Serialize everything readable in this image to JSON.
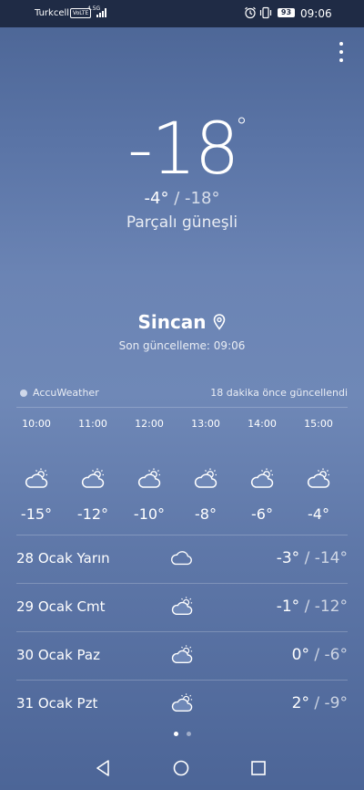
{
  "status_bar": {
    "carrier": "Turkcell",
    "volte": "VoLTE",
    "network": "4.5G",
    "battery": "93",
    "time": "09:06"
  },
  "current": {
    "temp": "-18",
    "unit": "°",
    "high": "-4°",
    "separator": "/",
    "low": "-18°",
    "condition": "Parçalı güneşli",
    "city": "Sincan",
    "updated": "Son güncelleme: 09:06"
  },
  "source": {
    "name": "AccuWeather",
    "updated_ago": "18 dakika önce güncellendi"
  },
  "hourly": [
    {
      "time": "10:00",
      "icon": "partly-sunny-icon",
      "temp": "-15°"
    },
    {
      "time": "11:00",
      "icon": "partly-sunny-icon",
      "temp": "-12°"
    },
    {
      "time": "12:00",
      "icon": "partly-sunny-icon",
      "temp": "-10°"
    },
    {
      "time": "13:00",
      "icon": "partly-sunny-icon",
      "temp": "-8°"
    },
    {
      "time": "14:00",
      "icon": "partly-sunny-icon",
      "temp": "-6°"
    },
    {
      "time": "15:00",
      "icon": "partly-sunny-icon",
      "temp": "-4°"
    }
  ],
  "daily": [
    {
      "label": "28 Ocak Yarın",
      "icon": "cloud-icon",
      "high": "-3°",
      "separator": "/",
      "low": "-14°"
    },
    {
      "label": "29 Ocak Cmt",
      "icon": "partly-sunny-icon",
      "high": "-1°",
      "separator": "/",
      "low": "-12°"
    },
    {
      "label": "30 Ocak Paz",
      "icon": "partly-sunny-icon",
      "high": "0°",
      "separator": "/",
      "low": "-6°"
    },
    {
      "label": "31 Ocak Pzt",
      "icon": "partly-sunny-icon",
      "high": "2°",
      "separator": "/",
      "low": "-9°"
    }
  ],
  "pager": {
    "count": 2,
    "active": 0
  },
  "colors": {
    "background_top": "#4b6494",
    "background_mid": "#6f88b7",
    "status_bar": "#1f2b45",
    "text": "#ffffff"
  }
}
